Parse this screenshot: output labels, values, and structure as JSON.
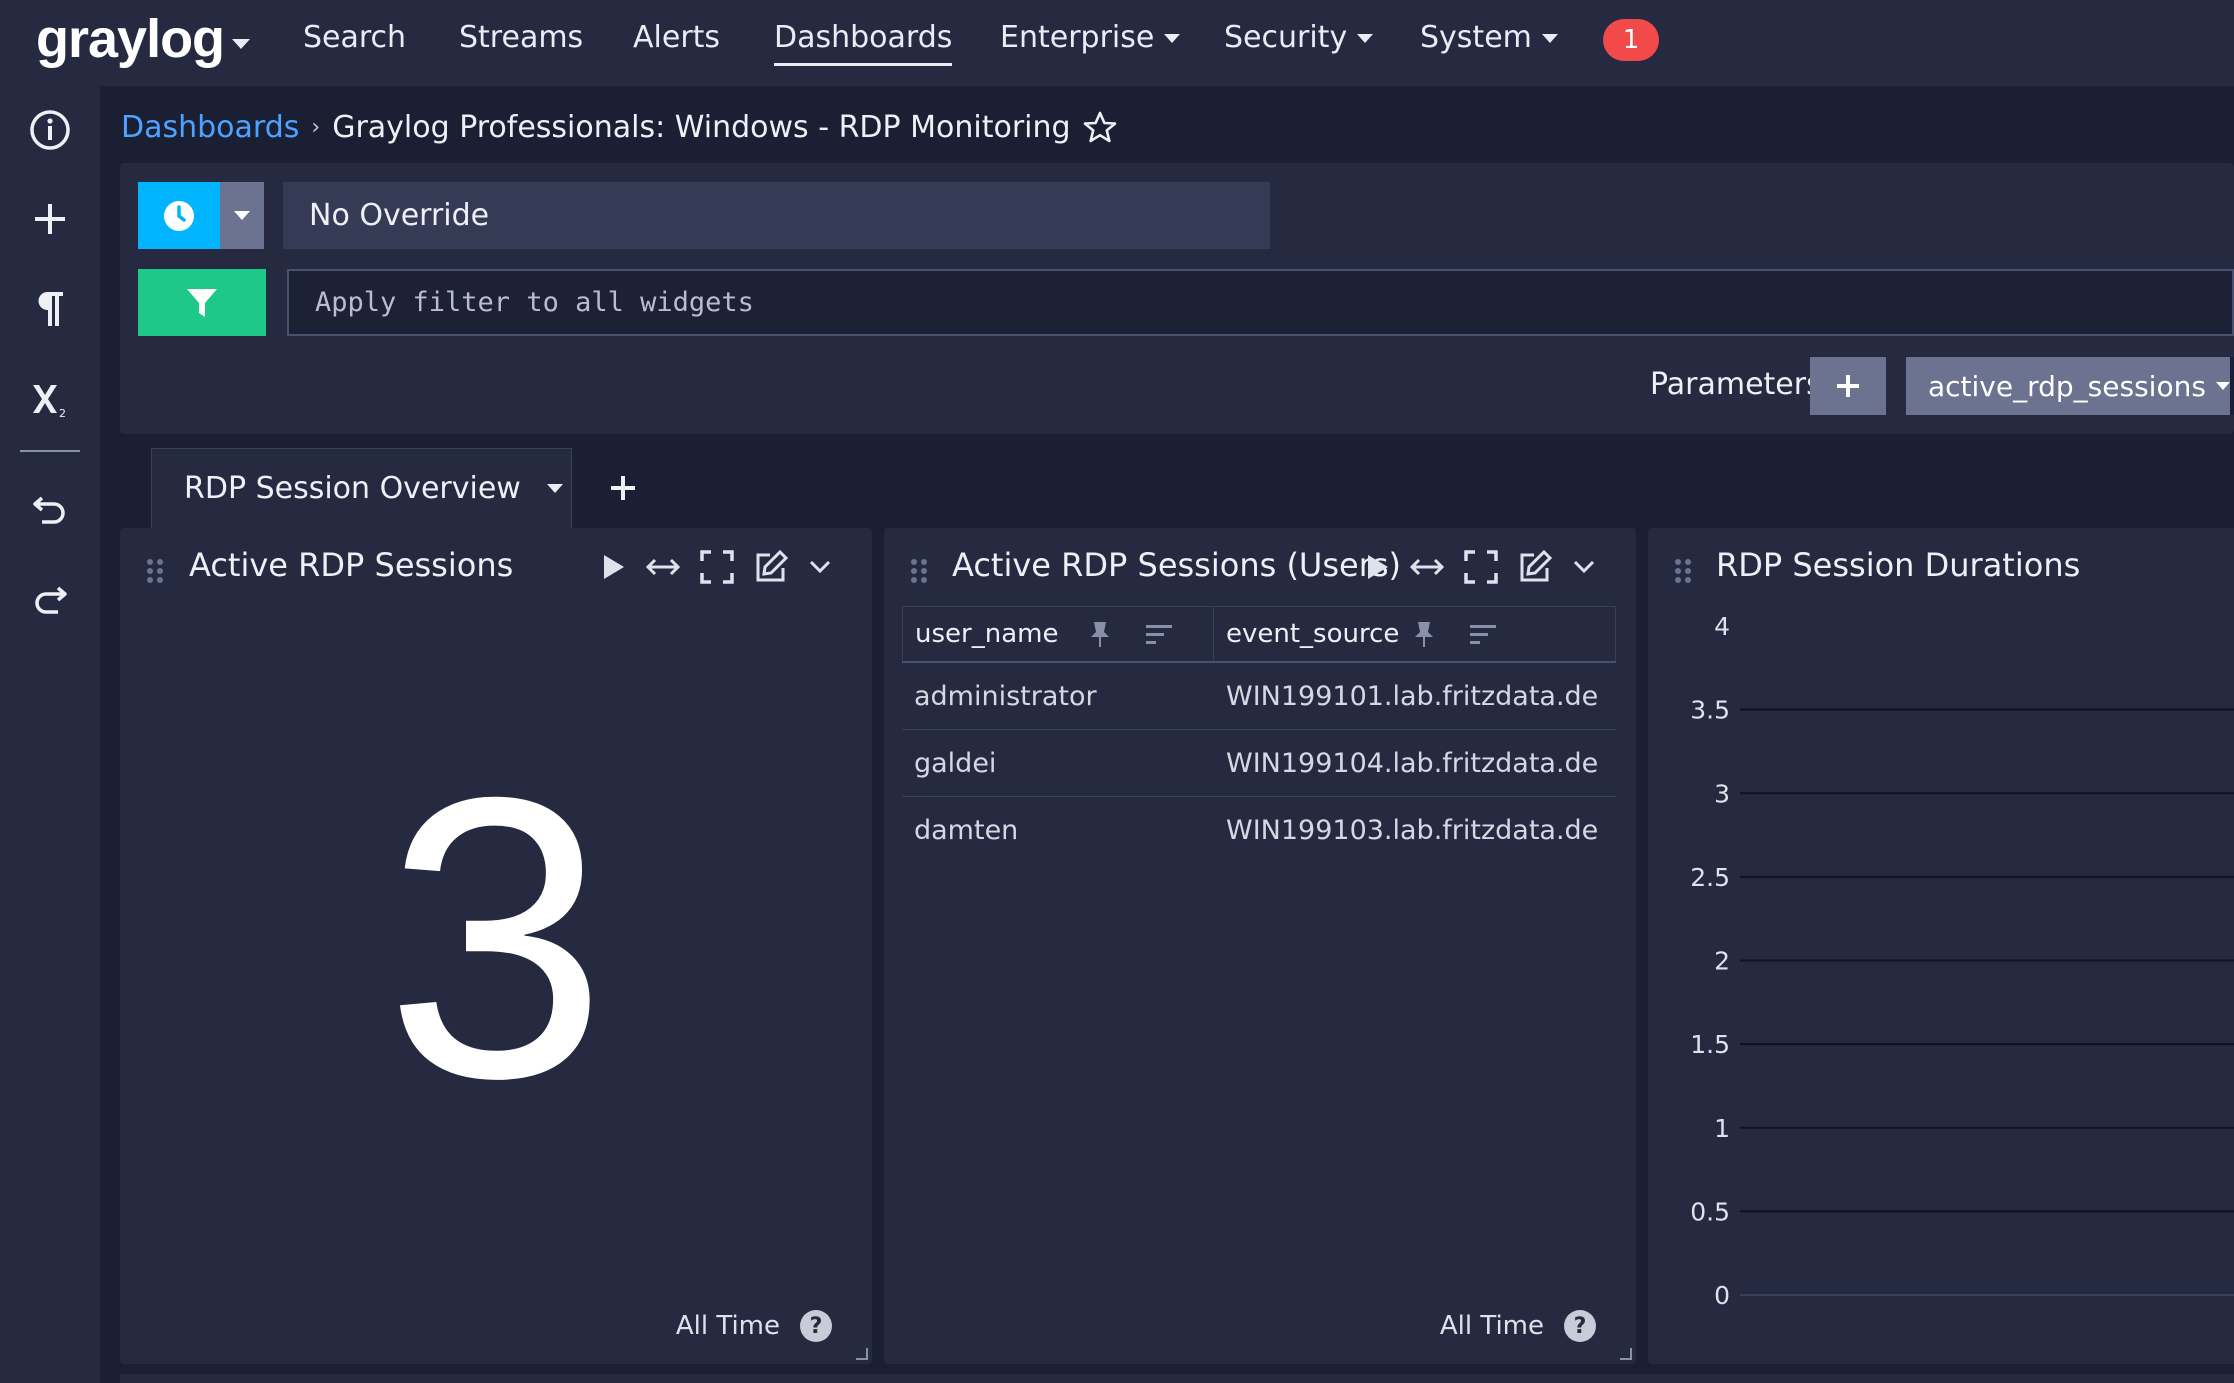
{
  "navbar": {
    "logo": "graylog",
    "items": {
      "search": "Search",
      "streams": "Streams",
      "alerts": "Alerts",
      "dashboards": "Dashboards",
      "enterprise": "Enterprise",
      "security": "Security",
      "system": "System"
    },
    "notification_count": "1"
  },
  "sidebar": {
    "icons": [
      "info-icon",
      "plus-icon",
      "paragraph-icon",
      "subscript-icon",
      "undo-icon",
      "redo-icon"
    ]
  },
  "breadcrumb": {
    "root": "Dashboards",
    "title": "Graylog Professionals: Windows - RDP Monitoring"
  },
  "query": {
    "time_override": "No Override",
    "filter_placeholder": "Apply filter to all widgets",
    "parameters_label": "Parameters",
    "parameter_name": "active_rdp_sessions"
  },
  "tabs": {
    "active": "RDP Session Overview"
  },
  "widgets": {
    "active_sessions": {
      "title": "Active RDP Sessions",
      "value": "3",
      "timerange": "All Time"
    },
    "users": {
      "title": "Active RDP Sessions (Users)",
      "columns": [
        "user_name",
        "event_source"
      ],
      "rows": [
        [
          "administrator",
          "WIN199101.lab.fritzdata.de"
        ],
        [
          "galdei",
          "WIN199104.lab.fritzdata.de"
        ],
        [
          "damten",
          "WIN199103.lab.fritzdata.de"
        ]
      ],
      "timerange": "All Time"
    },
    "durations": {
      "title": "RDP Session Durations"
    }
  },
  "chart_data": {
    "type": "line",
    "title": "RDP Session Durations",
    "yticks": [
      "4",
      "3.5",
      "3",
      "2.5",
      "2",
      "1.5",
      "1",
      "0.5",
      "0"
    ],
    "ylim": [
      0,
      4
    ],
    "grid": true,
    "series": []
  },
  "colors": {
    "time_button": "#00b4ff",
    "filter_button": "#1ec887",
    "badge": "#f24a4a",
    "link": "#4da3ff"
  }
}
